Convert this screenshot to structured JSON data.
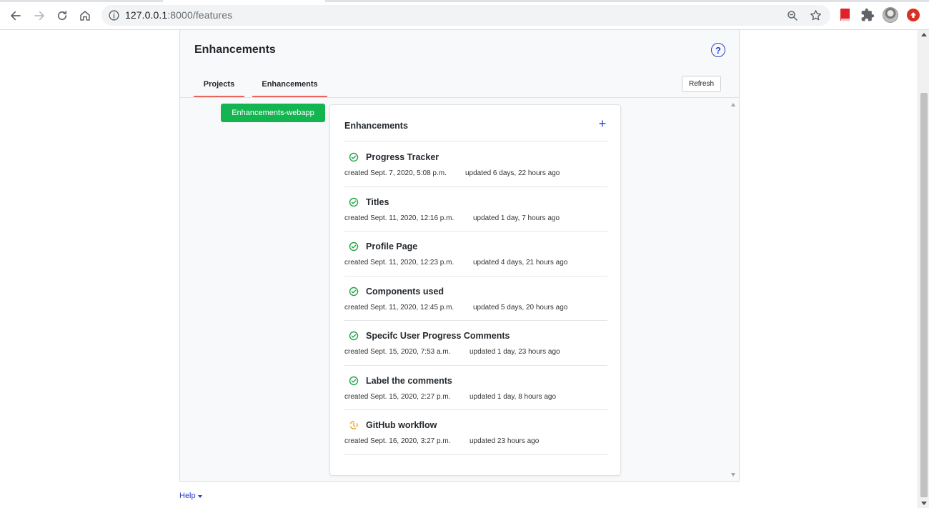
{
  "browser": {
    "url_host": "127.0.0.1",
    "url_path": ":8000/features"
  },
  "panel": {
    "title": "Enhancements",
    "help_symbol": "?",
    "tabs": [
      {
        "label": "Projects"
      },
      {
        "label": "Enhancements"
      }
    ],
    "refresh_label": "Refresh"
  },
  "project_chip": {
    "label": "Enhancements-webapp"
  },
  "card": {
    "title": "Enhancements",
    "add_symbol": "+",
    "items": [
      {
        "title": "Progress Tracker",
        "status": "done",
        "created": "created Sept. 7, 2020, 5:08 p.m.",
        "updated": "updated 6 days, 22 hours ago"
      },
      {
        "title": "Titles",
        "status": "done",
        "created": "created Sept. 11, 2020, 12:16 p.m.",
        "updated": "updated 1 day, 7 hours ago"
      },
      {
        "title": "Profile Page",
        "status": "done",
        "created": "created Sept. 11, 2020, 12:23 p.m.",
        "updated": "updated 4 days, 21 hours ago"
      },
      {
        "title": "Components used",
        "status": "done",
        "created": "created Sept. 11, 2020, 12:45 p.m.",
        "updated": "updated 5 days, 20 hours ago"
      },
      {
        "title": "Specifc User Progress Comments",
        "status": "done",
        "created": "created Sept. 15, 2020, 7:53 a.m.",
        "updated": "updated 1 day, 23 hours ago"
      },
      {
        "title": "Label the comments",
        "status": "done",
        "created": "created Sept. 15, 2020, 2:27 p.m.",
        "updated": "updated 1 day, 8 hours ago"
      },
      {
        "title": "GitHub workflow",
        "status": "in-progress",
        "created": "created Sept. 16, 2020, 3:27 p.m.",
        "updated": "updated 23 hours ago"
      }
    ]
  },
  "footer": {
    "help_label": "Help"
  },
  "colors": {
    "accent_blue": "#2d3fc9",
    "done_green": "#22a447",
    "progress_orange": "#f0a020",
    "chip_green": "#13b551",
    "tab_underline": "#e9645a"
  }
}
